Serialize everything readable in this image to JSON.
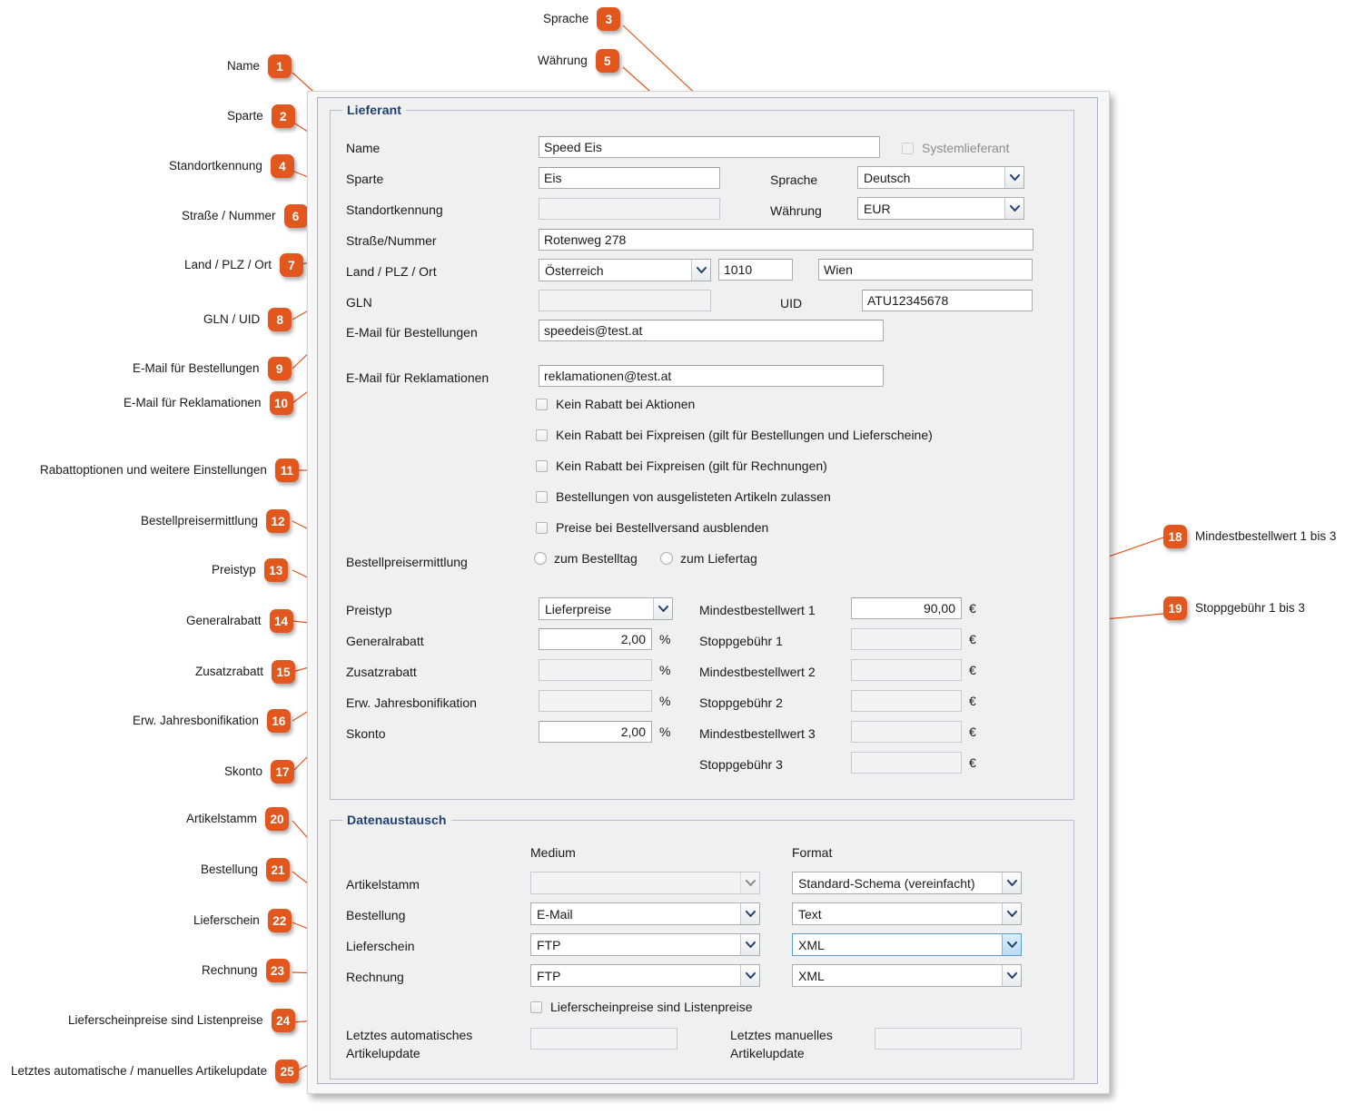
{
  "window": {
    "groups": {
      "lieferant": "Lieferant",
      "datenaustausch": "Datenaustausch"
    }
  },
  "lieferant": {
    "labels": {
      "name": "Name",
      "sparte": "Sparte",
      "standortkennung": "Standortkennung",
      "strasse": "Straße/Nummer",
      "land_plz_ort": "Land / PLZ / Ort",
      "gln": "GLN",
      "uid": "UID",
      "email_bestellungen": "E-Mail für Bestellungen",
      "email_reklamationen": "E-Mail für Reklamationen",
      "sprache": "Sprache",
      "waehrung": "Währung",
      "bestellpreisermittlung": "Bestellpreisermittlung",
      "preistyp": "Preistyp",
      "generalrabatt": "Generalrabatt",
      "zusatzrabatt": "Zusatzrabatt",
      "erw_jahresbonifikation": "Erw. Jahresbonifikation",
      "skonto": "Skonto"
    },
    "values": {
      "name": "Speed Eis",
      "sparte": "Eis",
      "standortkennung": "",
      "strasse": "Rotenweg 278",
      "land": "Österreich",
      "plz": "1010",
      "ort": "Wien",
      "gln": "",
      "uid": "ATU12345678",
      "email_bestellungen": "speedeis@test.at",
      "email_reklamationen": "reklamationen@test.at",
      "sprache": "Deutsch",
      "waehrung": "EUR",
      "preistyp": "Lieferpreise",
      "generalrabatt": "2,00",
      "zusatzrabatt": "",
      "erw_jahresbonifikation": "",
      "skonto": "2,00"
    },
    "systemlieferant": "Systemlieferant",
    "checkboxes": [
      "Kein Rabatt bei Aktionen",
      "Kein Rabatt bei Fixpreisen (gilt für Bestellungen und Lieferscheine)",
      "Kein Rabatt bei Fixpreisen (gilt für Rechnungen)",
      "Bestellungen von ausgelisteten Artikeln zulassen",
      "Preise bei Bestellversand ausblenden"
    ],
    "radios": [
      "zum Bestelltag",
      "zum Liefertag"
    ],
    "units": {
      "percent": "%",
      "euro": "€"
    },
    "limits": [
      {
        "label": "Mindestbestellwert 1",
        "value": "90,00"
      },
      {
        "label": "Stoppgebühr 1",
        "value": ""
      },
      {
        "label": "Mindestbestellwert 2",
        "value": ""
      },
      {
        "label": "Stoppgebühr 2",
        "value": ""
      },
      {
        "label": "Mindestbestellwert 3",
        "value": ""
      },
      {
        "label": "Stoppgebühr 3",
        "value": ""
      }
    ]
  },
  "datenaustausch": {
    "columns": {
      "medium": "Medium",
      "format": "Format"
    },
    "rows": [
      {
        "label": "Artikelstamm",
        "medium": "",
        "format": "Standard-Schema (vereinfacht)",
        "format_focused": false,
        "medium_empty": true
      },
      {
        "label": "Bestellung",
        "medium": "E-Mail",
        "format": "Text",
        "format_focused": false,
        "medium_empty": false
      },
      {
        "label": "Lieferschein",
        "medium": "FTP",
        "format": "XML",
        "format_focused": true,
        "medium_empty": false
      },
      {
        "label": "Rechnung",
        "medium": "FTP",
        "format": "XML",
        "format_focused": false,
        "medium_empty": false
      }
    ],
    "lieferscheinpreise_checkbox": "Lieferscheinpreise sind Listenpreise",
    "letztes_auto_label": "Letztes automatisches\nArtikelupdate",
    "letztes_auto_label_l1": "Letztes automatisches",
    "letztes_auto_label_l2": "Artikelupdate",
    "letztes_manuell_label_l1": "Letztes manuelles",
    "letztes_manuell_label_l2": "Artikelupdate",
    "letztes_auto_value": "",
    "letztes_manuell_value": ""
  },
  "annotations": [
    {
      "n": "1",
      "text": "Name"
    },
    {
      "n": "2",
      "text": "Sparte"
    },
    {
      "n": "3",
      "text": "Sprache"
    },
    {
      "n": "4",
      "text": "Standortkennung"
    },
    {
      "n": "5",
      "text": "Währung"
    },
    {
      "n": "6",
      "text": "Straße / Nummer"
    },
    {
      "n": "7",
      "text": "Land / PLZ / Ort"
    },
    {
      "n": "8",
      "text": "GLN / UID"
    },
    {
      "n": "9",
      "text": "E-Mail für Bestellungen"
    },
    {
      "n": "10",
      "text": "E-Mail für Reklamationen"
    },
    {
      "n": "11",
      "text": "Rabattoptionen und weitere Einstellungen"
    },
    {
      "n": "12",
      "text": "Bestellpreisermittlung"
    },
    {
      "n": "13",
      "text": "Preistyp"
    },
    {
      "n": "14",
      "text": "Generalrabatt"
    },
    {
      "n": "15",
      "text": "Zusatzrabatt"
    },
    {
      "n": "16",
      "text": "Erw. Jahresbonifikation"
    },
    {
      "n": "17",
      "text": "Skonto"
    },
    {
      "n": "18",
      "text": "Mindestbestellwert 1 bis 3"
    },
    {
      "n": "19",
      "text": "Stoppgebühr 1 bis 3"
    },
    {
      "n": "20",
      "text": "Artikelstamm"
    },
    {
      "n": "21",
      "text": "Bestellung"
    },
    {
      "n": "22",
      "text": "Lieferschein"
    },
    {
      "n": "23",
      "text": "Rechnung"
    },
    {
      "n": "24",
      "text": "Lieferscheinpreise sind Listenpreise"
    },
    {
      "n": "25",
      "text": "Letztes automatische / manuelles Artikelupdate"
    }
  ],
  "colors": {
    "accent": "#e2571e",
    "group_title": "#1f3f73",
    "panel_bg": "#f0f0f0",
    "focus_border": "#5c9ccc"
  }
}
